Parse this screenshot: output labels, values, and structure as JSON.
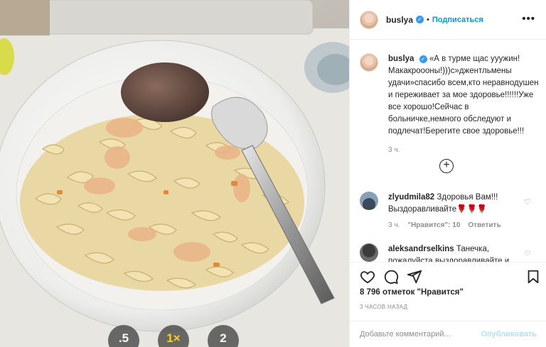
{
  "photo": {
    "zoom_options": [
      ".5",
      "1×",
      "2"
    ],
    "active_zoom": "1×"
  },
  "header": {
    "username": "buslya",
    "verified": "✓",
    "separator": "•",
    "follow_label": "Подписаться",
    "more_icon": "more-horizontal-icon"
  },
  "caption": {
    "username": "buslya",
    "text": "«А в турме щас ууужин! Макакроооны!)))с»джентльмены удачи»спасибо всем,кто неравнодушен и переживает за мое здоровье!!!!!!Уже все хорошо!Сейчас в больничке,немного обследуют и подлечат!Берегите свое здоровье!!!",
    "time": "3 ч."
  },
  "load_more_icon": "plus-circle-icon",
  "comments": [
    {
      "username": "zlyudmila82",
      "text": "Здоровья Вам!!! Выздоравливайте",
      "emoji": "🌹🌹🌹",
      "time": "3 ч.",
      "likes": "\"Нравится\": 10",
      "reply": "Ответить"
    },
    {
      "username": "aleksandrselkins",
      "text": "Танечка, пожалуйста выздоравливайте и"
    }
  ],
  "actions": {
    "like_icon": "heart-icon",
    "comment_icon": "comment-icon",
    "share_icon": "share-icon",
    "save_icon": "bookmark-icon",
    "likes_text": "8 796 отметок \"Нравится\"",
    "post_time": "3 ЧАСОВ НАЗАД"
  },
  "composer": {
    "placeholder": "Добавьте комментарий...",
    "publish_label": "Опубликовать"
  },
  "colors": {
    "accent": "#0095f6",
    "verified": "#3897f0",
    "muted": "#8e8e8e",
    "publish_disabled": "#b2dffc"
  }
}
